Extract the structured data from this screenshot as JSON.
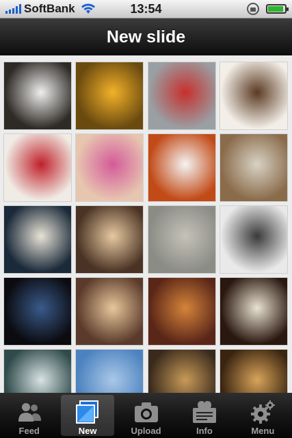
{
  "status_bar": {
    "carrier": "SoftBank",
    "time": "13:54",
    "battery_level": 0.9
  },
  "nav": {
    "title": "New slide"
  },
  "photos": [
    {
      "name": "photo-bakery-bag",
      "color": "#2e2a26",
      "accent": "#eeeeee"
    },
    {
      "name": "photo-live-concert",
      "color": "#6b4a10",
      "accent": "#f2b229"
    },
    {
      "name": "photo-man-newspaper",
      "color": "#9a9fa4",
      "accent": "#c7302c"
    },
    {
      "name": "photo-pastry-illustration",
      "color": "#f3efe8",
      "accent": "#5b3a22"
    },
    {
      "name": "photo-sake-bottle-red",
      "color": "#f0ece5",
      "accent": "#c0202a"
    },
    {
      "name": "photo-ice-cream-sundaes",
      "color": "#e7c6b0",
      "accent": "#d45b9a"
    },
    {
      "name": "photo-sleeping-cat",
      "color": "#c24a16",
      "accent": "#f4f4f4"
    },
    {
      "name": "photo-shop-interior",
      "color": "#8a6b4a",
      "accent": "#d8d2c4"
    },
    {
      "name": "photo-sake-bottle-dark",
      "color": "#1b2a3a",
      "accent": "#e8e3d6"
    },
    {
      "name": "photo-restaurant-group",
      "color": "#4a3324",
      "accent": "#e7c9a1"
    },
    {
      "name": "photo-stadium-building",
      "color": "#8b8c86",
      "accent": "#c5c2b7"
    },
    {
      "name": "photo-tokyo-tower",
      "color": "#e9e9e9",
      "accent": "#3a3a3a"
    },
    {
      "name": "photo-video-screen",
      "color": "#0b0b10",
      "accent": "#3a5a8a"
    },
    {
      "name": "photo-dinner-party",
      "color": "#5a3a2a",
      "accent": "#e8c69c"
    },
    {
      "name": "photo-shaved-ice-dessert",
      "color": "#5a2618",
      "accent": "#d5843a"
    },
    {
      "name": "photo-duffer-mug",
      "color": "#2a1810",
      "accent": "#e9e2d1"
    },
    {
      "name": "photo-framed-flower",
      "color": "#2f4a4a",
      "accent": "#d9e3e3"
    },
    {
      "name": "photo-blue-sky",
      "color": "#4c82bf",
      "accent": "#a9c8e8"
    },
    {
      "name": "photo-escalator-tunnel",
      "color": "#3a2a1c",
      "accent": "#c89a58"
    },
    {
      "name": "photo-drinks-table",
      "color": "#3a2410",
      "accent": "#d8a45a"
    }
  ],
  "tabs": [
    {
      "label": "Feed",
      "icon": "people-icon",
      "active": false
    },
    {
      "label": "New",
      "icon": "slideshow-icon",
      "active": true
    },
    {
      "label": "Upload",
      "icon": "camera-icon",
      "active": false
    },
    {
      "label": "Info",
      "icon": "info-card-icon",
      "active": false
    },
    {
      "label": "Menu",
      "icon": "gear-icon",
      "active": false
    }
  ]
}
